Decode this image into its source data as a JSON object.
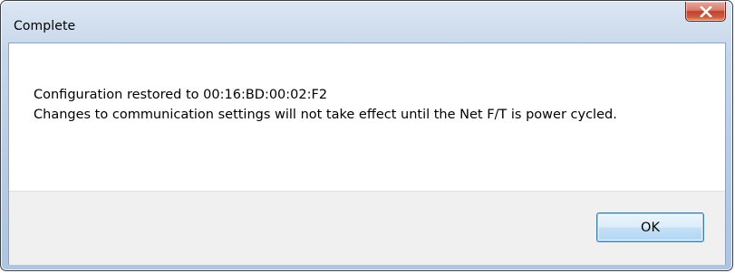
{
  "window": {
    "title": "Complete"
  },
  "title_bar": {
    "close_icon": "close-x-icon"
  },
  "message": {
    "line1": "Configuration restored to 00:16:BD:00:02:F2",
    "line2": "Changes to communication settings will not take effect until the Net F/T is power cycled."
  },
  "buttons": {
    "ok_label": "OK"
  },
  "colors": {
    "close_button_red": "#c0412f",
    "ok_button_border": "#3c7fb1",
    "frame_blue": "#b9cce4",
    "footer_gray": "#f0f0f0"
  }
}
